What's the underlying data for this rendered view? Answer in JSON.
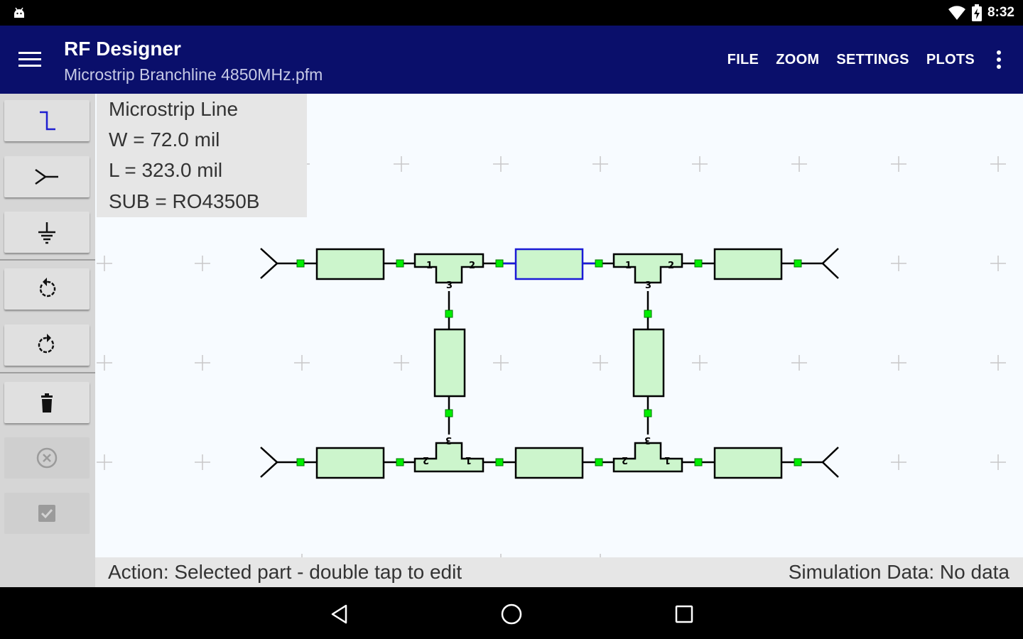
{
  "status_bar": {
    "time": "8:32",
    "icons": [
      "android-debug-icon",
      "wifi-icon",
      "battery-charging-icon"
    ]
  },
  "app_bar": {
    "title": "RF Designer",
    "subtitle": "Microstrip Branchline 4850MHz.pfm",
    "actions": [
      "FILE",
      "ZOOM",
      "SETTINGS",
      "PLOTS"
    ],
    "background_color": "#0a0f6b"
  },
  "toolbar": {
    "tools": [
      {
        "name": "transmission-line-icon",
        "enabled": true
      },
      {
        "name": "port-icon",
        "enabled": true
      },
      {
        "name": "ground-icon",
        "enabled": true
      },
      {
        "name": "rotate-ccw-icon",
        "enabled": true
      },
      {
        "name": "rotate-cw-icon",
        "enabled": true
      },
      {
        "name": "delete-icon",
        "enabled": true
      },
      {
        "name": "cancel-icon",
        "enabled": false
      },
      {
        "name": "confirm-icon",
        "enabled": false
      }
    ]
  },
  "selected_part": {
    "type": "Microstrip Line",
    "width": "W = 72.0 mil",
    "length": "L = 323.0 mil",
    "substrate": "SUB = RO4350B"
  },
  "schematic": {
    "tee_port_labels": [
      "1",
      "2",
      "3"
    ],
    "colors": {
      "component_fill": "#ccf5cc",
      "node": "#00ee00",
      "selected": "#1a1ad6",
      "wire": "#000000",
      "grid": "#c8c8c8"
    }
  },
  "bottom_bar": {
    "action_text": "Action: Selected part - double tap to edit",
    "simulation_text": "Simulation Data: No data"
  },
  "nav_bar": {
    "buttons": [
      "back-icon",
      "home-icon",
      "recents-icon"
    ]
  }
}
